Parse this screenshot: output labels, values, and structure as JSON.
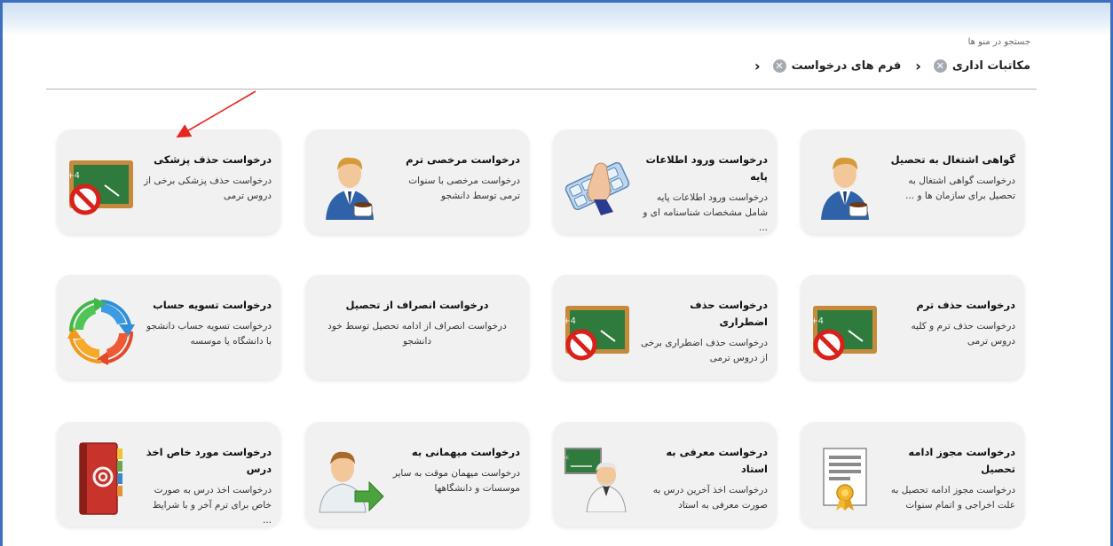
{
  "search": {
    "hint": "جستجو در منو ها"
  },
  "breadcrumb": {
    "items": [
      {
        "label": "مکاتبات اداری"
      },
      {
        "label": "فرم های درخواست"
      }
    ],
    "close_glyph": "✕",
    "sep_glyph": "‹"
  },
  "cards": [
    {
      "title": "گواهی اشتغال به تحصیل",
      "desc": "درخواست گواهی اشتغال به تحصیل برای سازمان ها و ...",
      "icon": "businessman-icon"
    },
    {
      "title": "درخواست ورود اطلاعات پایه",
      "desc": "درخواست ورود اطلاعات پایه شامل مشخصات شناسنامه ای و ...",
      "icon": "keyboard-hand-icon"
    },
    {
      "title": "درخواست مرخصی ترم",
      "desc": "درخواست مرخصی با سنوات ترمی توسط دانشجو",
      "icon": "businessman-icon"
    },
    {
      "title": "درخواست حذف پزشکی",
      "desc": "درخواست حذف پزشکی برخی از دروس ترمی",
      "icon": "blackboard-forbidden-icon"
    },
    {
      "title": "درخواست حذف ترم",
      "desc": "درخواست حذف ترم و کلیه دروس ترمی",
      "icon": "blackboard-forbidden-icon"
    },
    {
      "title": "درخواست حذف اضطراری",
      "desc": "درخواست حذف اضطراری برخی از دروس ترمی",
      "icon": "blackboard-forbidden-icon"
    },
    {
      "title": "درخواست انصراف از تحصیل",
      "desc": "درخواست انصراف از ادامه تحصیل توسط خود دانشجو",
      "icon": ""
    },
    {
      "title": "درخواست تسویه حساب",
      "desc": "درخواست تسویه حساب دانشجو با دانشگاه یا موسسه",
      "icon": "cycle-arrows-icon"
    },
    {
      "title": "درخواست مجوز ادامه تحصیل",
      "desc": "درخواست مجوز ادامه تحصیل به علت اخراجی و اتمام سنوات",
      "icon": "certificate-icon"
    },
    {
      "title": "درخواست معرفی به استاد",
      "desc": "درخواست اخذ آخرین درس به صورت معرفی به استاد",
      "icon": "professor-icon"
    },
    {
      "title": "درخواست میهمانی به",
      "desc": "درخواست میهمان موقت به سایر موسسات و دانشگاهها",
      "icon": "user-arrow-icon"
    },
    {
      "title": "درخواست مورد خاص اخذ درس",
      "desc": "درخواست اخذ درس به صورت خاص برای ترم آخر و با شرایط ...",
      "icon": "address-book-icon"
    }
  ],
  "colors": {
    "frame": "#3d6fbf",
    "card_bg": "#f1f1f1",
    "arrow": "#e8271f"
  }
}
